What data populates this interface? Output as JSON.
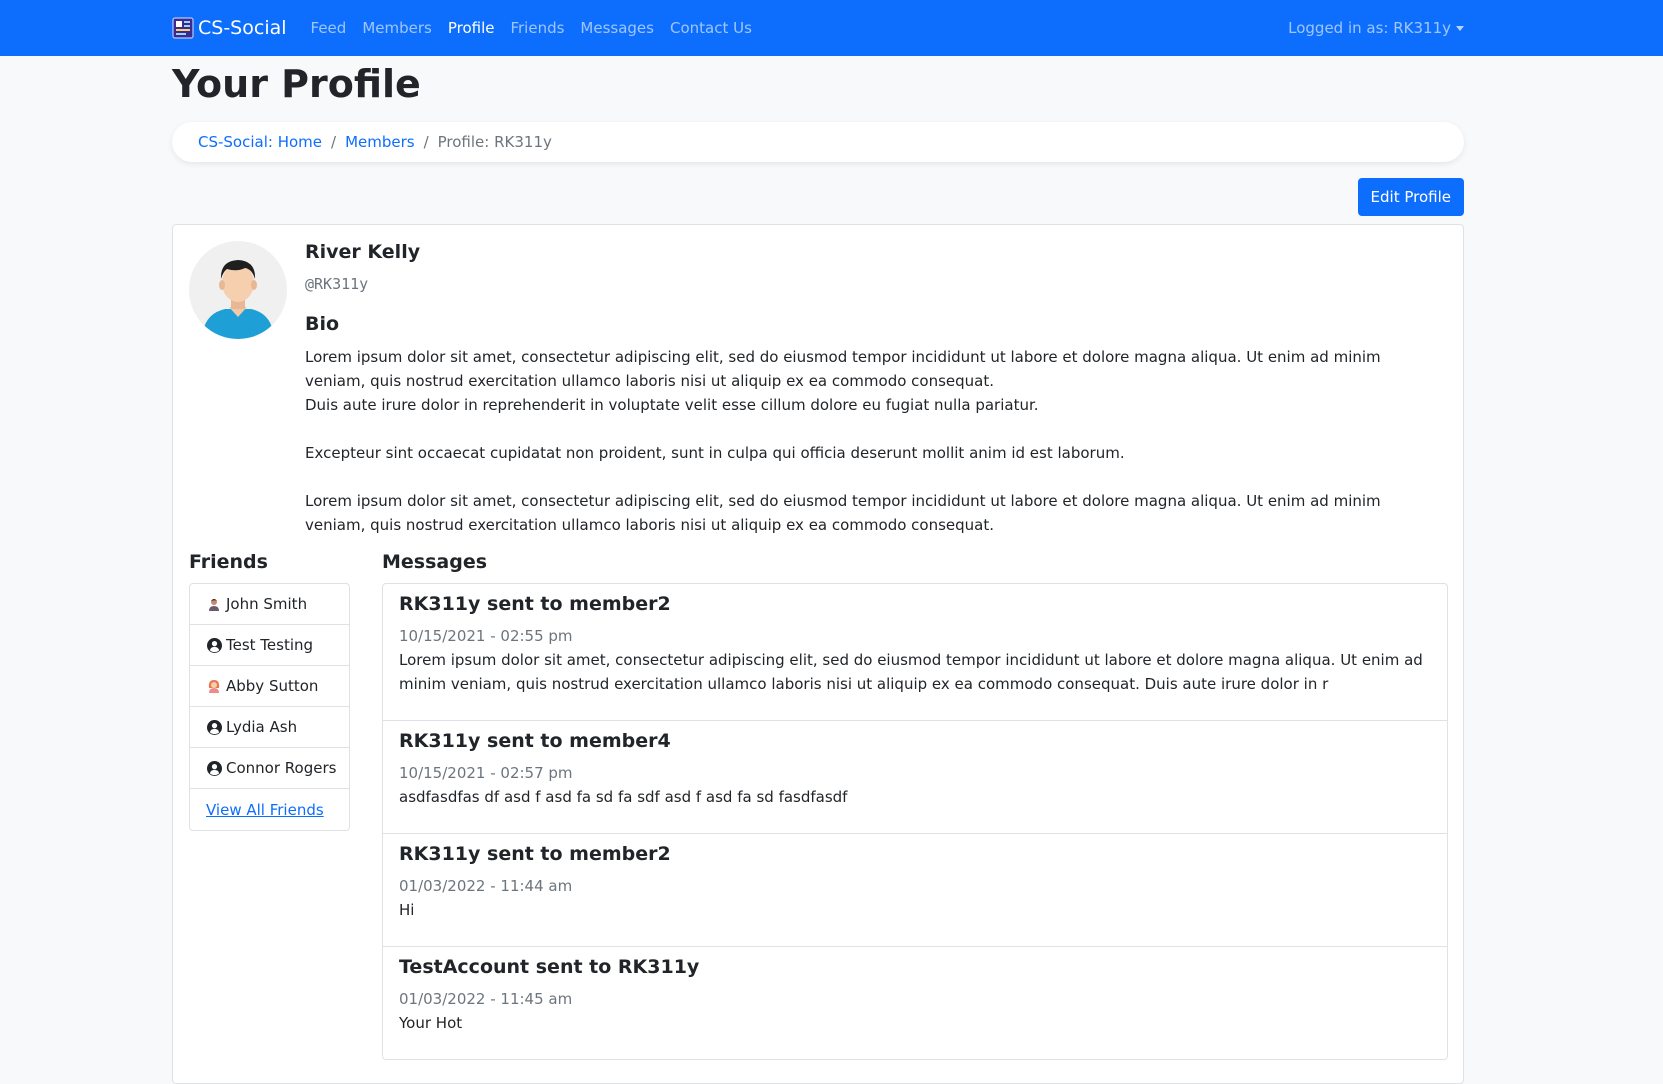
{
  "nav": {
    "brand": "CS-Social",
    "links": [
      "Feed",
      "Members",
      "Profile",
      "Friends",
      "Messages",
      "Contact Us"
    ],
    "active": "Profile",
    "user_menu": "Logged in as: RK311y"
  },
  "page_title": "Your Profile",
  "breadcrumb": {
    "home": "CS-Social: Home",
    "members": "Members",
    "current": "Profile: RK311y"
  },
  "edit_button": "Edit Profile",
  "profile": {
    "name": "River Kelly",
    "handle": "@RK311y",
    "bio_title": "Bio",
    "bio_paragraphs": [
      "Lorem ipsum dolor sit amet, consectetur adipiscing elit, sed do eiusmod tempor incididunt ut labore et dolore magna aliqua. Ut enim ad minim veniam, quis nostrud exercitation ullamco laboris nisi ut aliquip ex ea commodo consequat.",
      "Duis aute irure dolor in reprehenderit in voluptate velit esse cillum dolore eu fugiat nulla pariatur.",
      "Excepteur sint occaecat cupidatat non proident, sunt in culpa qui officia deserunt mollit anim id est laborum.",
      "Lorem ipsum dolor sit amet, consectetur adipiscing elit, sed do eiusmod tempor incididunt ut labore et dolore magna aliqua. Ut enim ad minim veniam, quis nostrud exercitation ullamco laboris nisi ut aliquip ex ea commodo consequat."
    ]
  },
  "friends": {
    "title": "Friends",
    "items": [
      {
        "name": "John Smith",
        "icon": "user-photo-icon"
      },
      {
        "name": "Test Testing",
        "icon": "user-circle-icon"
      },
      {
        "name": "Abby Sutton",
        "icon": "user-photo-icon"
      },
      {
        "name": "Lydia Ash",
        "icon": "user-circle-icon"
      },
      {
        "name": "Connor Rogers",
        "icon": "user-circle-icon"
      }
    ],
    "view_all": "View All Friends"
  },
  "messages": {
    "title": "Messages",
    "items": [
      {
        "title": "RK311y sent to member2",
        "date": "10/15/2021 - 02:55 pm",
        "body": "Lorem ipsum dolor sit amet, consectetur adipiscing elit, sed do eiusmod tempor incididunt ut labore et dolore magna aliqua. Ut enim ad minim veniam, quis nostrud exercitation ullamco laboris nisi ut aliquip ex ea commodo consequat. Duis aute irure dolor in r"
      },
      {
        "title": "RK311y sent to member4",
        "date": "10/15/2021 - 02:57 pm",
        "body": "asdfasdfas df asd f asd fa sd fa sdf asd f asd fa sd fasdfasdf"
      },
      {
        "title": "RK311y sent to member2",
        "date": "01/03/2022 - 11:44 am",
        "body": "Hi"
      },
      {
        "title": "TestAccount sent to RK311y",
        "date": "01/03/2022 - 11:45 am",
        "body": "Your Hot"
      }
    ]
  },
  "colors": {
    "primary": "#0d6efd",
    "background": "#f8f9fa",
    "muted": "#6c757d"
  }
}
